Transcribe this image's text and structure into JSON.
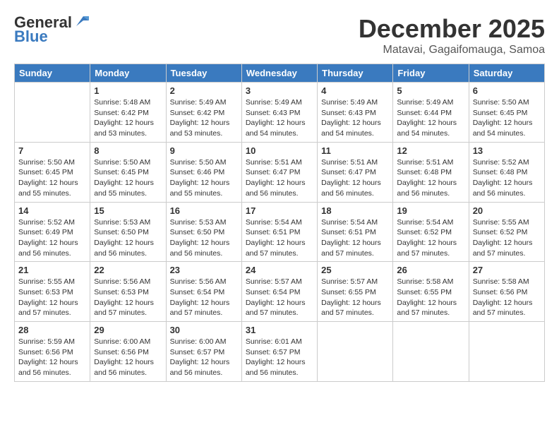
{
  "header": {
    "logo_line1": "General",
    "logo_line2": "Blue",
    "month": "December 2025",
    "location": "Matavai, Gagaifomauga, Samoa"
  },
  "days_of_week": [
    "Sunday",
    "Monday",
    "Tuesday",
    "Wednesday",
    "Thursday",
    "Friday",
    "Saturday"
  ],
  "weeks": [
    [
      {
        "day": "",
        "info": ""
      },
      {
        "day": "1",
        "info": "Sunrise: 5:48 AM\nSunset: 6:42 PM\nDaylight: 12 hours\nand 53 minutes."
      },
      {
        "day": "2",
        "info": "Sunrise: 5:49 AM\nSunset: 6:42 PM\nDaylight: 12 hours\nand 53 minutes."
      },
      {
        "day": "3",
        "info": "Sunrise: 5:49 AM\nSunset: 6:43 PM\nDaylight: 12 hours\nand 54 minutes."
      },
      {
        "day": "4",
        "info": "Sunrise: 5:49 AM\nSunset: 6:43 PM\nDaylight: 12 hours\nand 54 minutes."
      },
      {
        "day": "5",
        "info": "Sunrise: 5:49 AM\nSunset: 6:44 PM\nDaylight: 12 hours\nand 54 minutes."
      },
      {
        "day": "6",
        "info": "Sunrise: 5:50 AM\nSunset: 6:45 PM\nDaylight: 12 hours\nand 54 minutes."
      }
    ],
    [
      {
        "day": "7",
        "info": "Sunrise: 5:50 AM\nSunset: 6:45 PM\nDaylight: 12 hours\nand 55 minutes."
      },
      {
        "day": "8",
        "info": "Sunrise: 5:50 AM\nSunset: 6:45 PM\nDaylight: 12 hours\nand 55 minutes."
      },
      {
        "day": "9",
        "info": "Sunrise: 5:50 AM\nSunset: 6:46 PM\nDaylight: 12 hours\nand 55 minutes."
      },
      {
        "day": "10",
        "info": "Sunrise: 5:51 AM\nSunset: 6:47 PM\nDaylight: 12 hours\nand 56 minutes."
      },
      {
        "day": "11",
        "info": "Sunrise: 5:51 AM\nSunset: 6:47 PM\nDaylight: 12 hours\nand 56 minutes."
      },
      {
        "day": "12",
        "info": "Sunrise: 5:51 AM\nSunset: 6:48 PM\nDaylight: 12 hours\nand 56 minutes."
      },
      {
        "day": "13",
        "info": "Sunrise: 5:52 AM\nSunset: 6:48 PM\nDaylight: 12 hours\nand 56 minutes."
      }
    ],
    [
      {
        "day": "14",
        "info": "Sunrise: 5:52 AM\nSunset: 6:49 PM\nDaylight: 12 hours\nand 56 minutes."
      },
      {
        "day": "15",
        "info": "Sunrise: 5:53 AM\nSunset: 6:50 PM\nDaylight: 12 hours\nand 56 minutes."
      },
      {
        "day": "16",
        "info": "Sunrise: 5:53 AM\nSunset: 6:50 PM\nDaylight: 12 hours\nand 56 minutes."
      },
      {
        "day": "17",
        "info": "Sunrise: 5:54 AM\nSunset: 6:51 PM\nDaylight: 12 hours\nand 57 minutes."
      },
      {
        "day": "18",
        "info": "Sunrise: 5:54 AM\nSunset: 6:51 PM\nDaylight: 12 hours\nand 57 minutes."
      },
      {
        "day": "19",
        "info": "Sunrise: 5:54 AM\nSunset: 6:52 PM\nDaylight: 12 hours\nand 57 minutes."
      },
      {
        "day": "20",
        "info": "Sunrise: 5:55 AM\nSunset: 6:52 PM\nDaylight: 12 hours\nand 57 minutes."
      }
    ],
    [
      {
        "day": "21",
        "info": "Sunrise: 5:55 AM\nSunset: 6:53 PM\nDaylight: 12 hours\nand 57 minutes."
      },
      {
        "day": "22",
        "info": "Sunrise: 5:56 AM\nSunset: 6:53 PM\nDaylight: 12 hours\nand 57 minutes."
      },
      {
        "day": "23",
        "info": "Sunrise: 5:56 AM\nSunset: 6:54 PM\nDaylight: 12 hours\nand 57 minutes."
      },
      {
        "day": "24",
        "info": "Sunrise: 5:57 AM\nSunset: 6:54 PM\nDaylight: 12 hours\nand 57 minutes."
      },
      {
        "day": "25",
        "info": "Sunrise: 5:57 AM\nSunset: 6:55 PM\nDaylight: 12 hours\nand 57 minutes."
      },
      {
        "day": "26",
        "info": "Sunrise: 5:58 AM\nSunset: 6:55 PM\nDaylight: 12 hours\nand 57 minutes."
      },
      {
        "day": "27",
        "info": "Sunrise: 5:58 AM\nSunset: 6:56 PM\nDaylight: 12 hours\nand 57 minutes."
      }
    ],
    [
      {
        "day": "28",
        "info": "Sunrise: 5:59 AM\nSunset: 6:56 PM\nDaylight: 12 hours\nand 56 minutes."
      },
      {
        "day": "29",
        "info": "Sunrise: 6:00 AM\nSunset: 6:56 PM\nDaylight: 12 hours\nand 56 minutes."
      },
      {
        "day": "30",
        "info": "Sunrise: 6:00 AM\nSunset: 6:57 PM\nDaylight: 12 hours\nand 56 minutes."
      },
      {
        "day": "31",
        "info": "Sunrise: 6:01 AM\nSunset: 6:57 PM\nDaylight: 12 hours\nand 56 minutes."
      },
      {
        "day": "",
        "info": ""
      },
      {
        "day": "",
        "info": ""
      },
      {
        "day": "",
        "info": ""
      }
    ]
  ]
}
